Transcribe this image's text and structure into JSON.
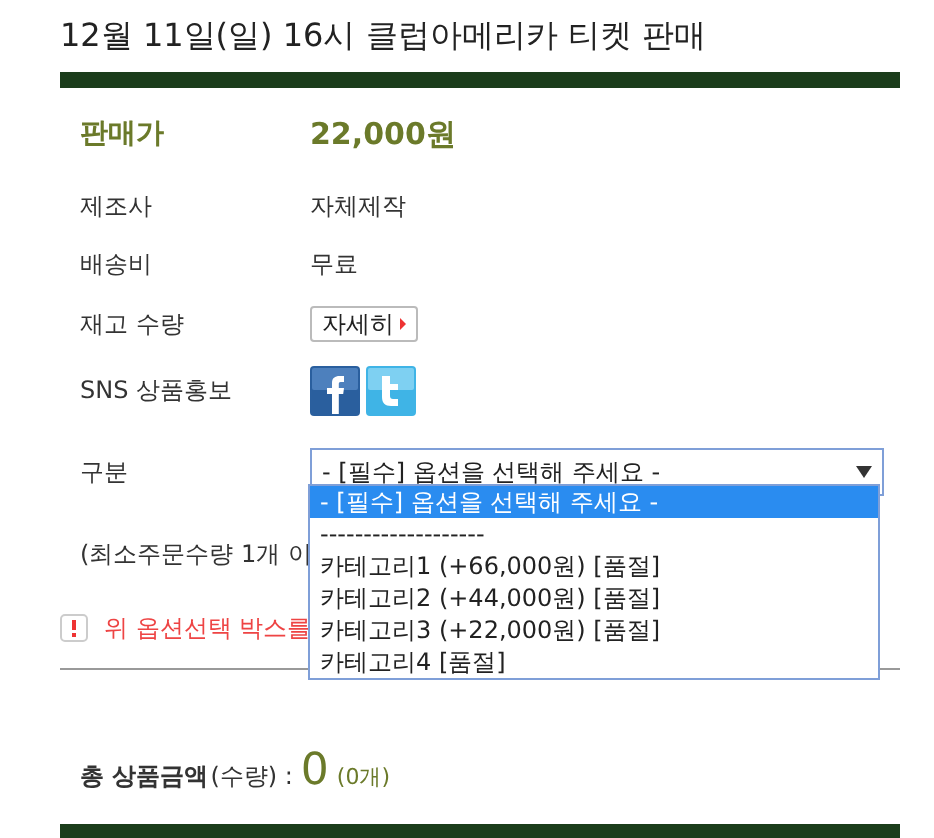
{
  "title": "12월 11일(일) 16시 클럽아메리카 티켓 판매",
  "price": {
    "label": "판매가",
    "value": "22,000원"
  },
  "info_rows": [
    {
      "label": "제조사",
      "value": "자체제작"
    },
    {
      "label": "배송비",
      "value": "무료"
    }
  ],
  "stock": {
    "label": "재고 수량",
    "button": "자세히"
  },
  "sns": {
    "label": "SNS 상품홍보"
  },
  "option": {
    "label": "구분",
    "value": "- [필수] 옵션을 선택해 주세요 -",
    "expanded": true,
    "options": [
      {
        "text": "- [필수] 옵션을 선택해 주세요 -",
        "selected": true
      },
      {
        "text": "-------------------",
        "selected": false
      },
      {
        "text": "카테고리1 (+66,000원) [품절]",
        "selected": false
      },
      {
        "text": "카테고리2 (+44,000원) [품절]",
        "selected": false
      },
      {
        "text": "카테고리3 (+22,000원) [품절]",
        "selected": false
      },
      {
        "text": "카테고리4 [품절]",
        "selected": false
      }
    ]
  },
  "min_order": "(최소주문수량 1개 이",
  "warning": "위 옵션선택 박스를",
  "total": {
    "label_bold": "총 상품금액",
    "label": "(수량) :",
    "amount": "0",
    "count": "(0개)"
  }
}
